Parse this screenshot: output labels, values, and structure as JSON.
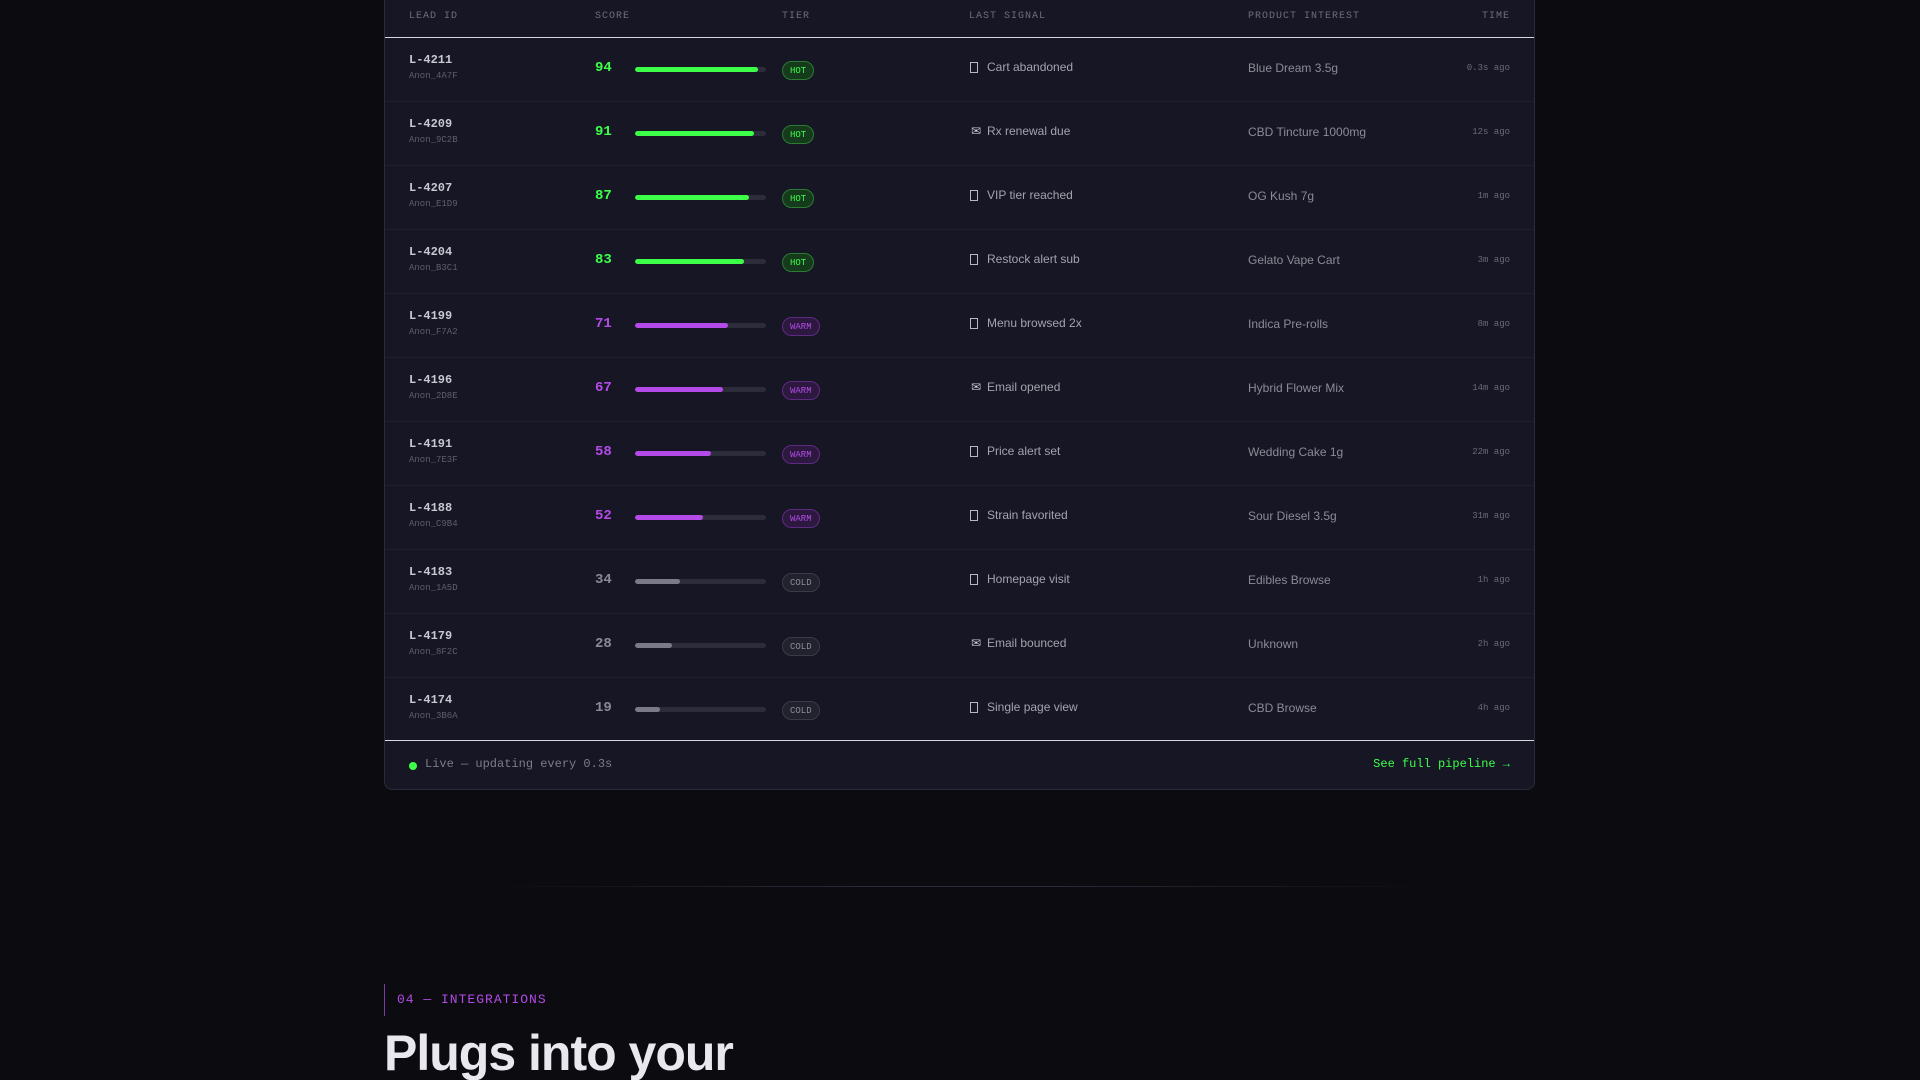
{
  "table": {
    "headers": {
      "lead_id": "LEAD ID",
      "score": "SCORE",
      "tier": "TIER",
      "last_signal": "LAST SIGNAL",
      "product_interest": "PRODUCT INTEREST",
      "time": "TIME"
    },
    "rows": [
      {
        "id": "L-4211",
        "anon": "Anon_4A7F",
        "score": 94,
        "tier": "HOT",
        "tier_class": "hot",
        "signal_icon": "phone-icon",
        "signal": "Cart abandoned",
        "product": "Blue Dream 3.5g",
        "time": "0.3s ago"
      },
      {
        "id": "L-4209",
        "anon": "Anon_9C2B",
        "score": 91,
        "tier": "HOT",
        "tier_class": "hot",
        "signal_icon": "envelope-icon",
        "signal": "Rx renewal due",
        "product": "CBD Tincture 1000mg",
        "time": "12s ago"
      },
      {
        "id": "L-4207",
        "anon": "Anon_E1D9",
        "score": 87,
        "tier": "HOT",
        "tier_class": "hot",
        "signal_icon": "phone-icon",
        "signal": "VIP tier reached",
        "product": "OG Kush 7g",
        "time": "1m ago"
      },
      {
        "id": "L-4204",
        "anon": "Anon_B3C1",
        "score": 83,
        "tier": "HOT",
        "tier_class": "hot",
        "signal_icon": "phone-icon",
        "signal": "Restock alert sub",
        "product": "Gelato Vape Cart",
        "time": "3m ago"
      },
      {
        "id": "L-4199",
        "anon": "Anon_F7A2",
        "score": 71,
        "tier": "WARM",
        "tier_class": "warm",
        "signal_icon": "phone-icon",
        "signal": "Menu browsed 2x",
        "product": "Indica Pre-rolls",
        "time": "8m ago"
      },
      {
        "id": "L-4196",
        "anon": "Anon_2D8E",
        "score": 67,
        "tier": "WARM",
        "tier_class": "warm",
        "signal_icon": "envelope-icon",
        "signal": "Email opened",
        "product": "Hybrid Flower Mix",
        "time": "14m ago"
      },
      {
        "id": "L-4191",
        "anon": "Anon_7E3F",
        "score": 58,
        "tier": "WARM",
        "tier_class": "warm",
        "signal_icon": "phone-icon",
        "signal": "Price alert set",
        "product": "Wedding Cake 1g",
        "time": "22m ago"
      },
      {
        "id": "L-4188",
        "anon": "Anon_C9B4",
        "score": 52,
        "tier": "WARM",
        "tier_class": "warm",
        "signal_icon": "phone-icon",
        "signal": "Strain favorited",
        "product": "Sour Diesel 3.5g",
        "time": "31m ago"
      },
      {
        "id": "L-4183",
        "anon": "Anon_1A5D",
        "score": 34,
        "tier": "COLD",
        "tier_class": "cold",
        "signal_icon": "phone-icon",
        "signal": "Homepage visit",
        "product": "Edibles Browse",
        "time": "1h ago"
      },
      {
        "id": "L-4179",
        "anon": "Anon_8F2C",
        "score": 28,
        "tier": "COLD",
        "tier_class": "cold",
        "signal_icon": "envelope-icon",
        "signal": "Email bounced",
        "product": "Unknown",
        "time": "2h ago"
      },
      {
        "id": "L-4174",
        "anon": "Anon_3B6A",
        "score": 19,
        "tier": "COLD",
        "tier_class": "cold",
        "signal_icon": "phone-icon",
        "signal": "Single page view",
        "product": "CBD Browse",
        "time": "4h ago"
      }
    ]
  },
  "footer": {
    "live_text": "Live — updating every 0.3s",
    "link_label": "See full pipeline →"
  },
  "section": {
    "eyebrow": "04 — INTEGRATIONS",
    "headline": "Plugs into your"
  },
  "colors": {
    "hot": "#3dff4a",
    "warm": "#b44be8",
    "cold": "#7a7a88"
  }
}
